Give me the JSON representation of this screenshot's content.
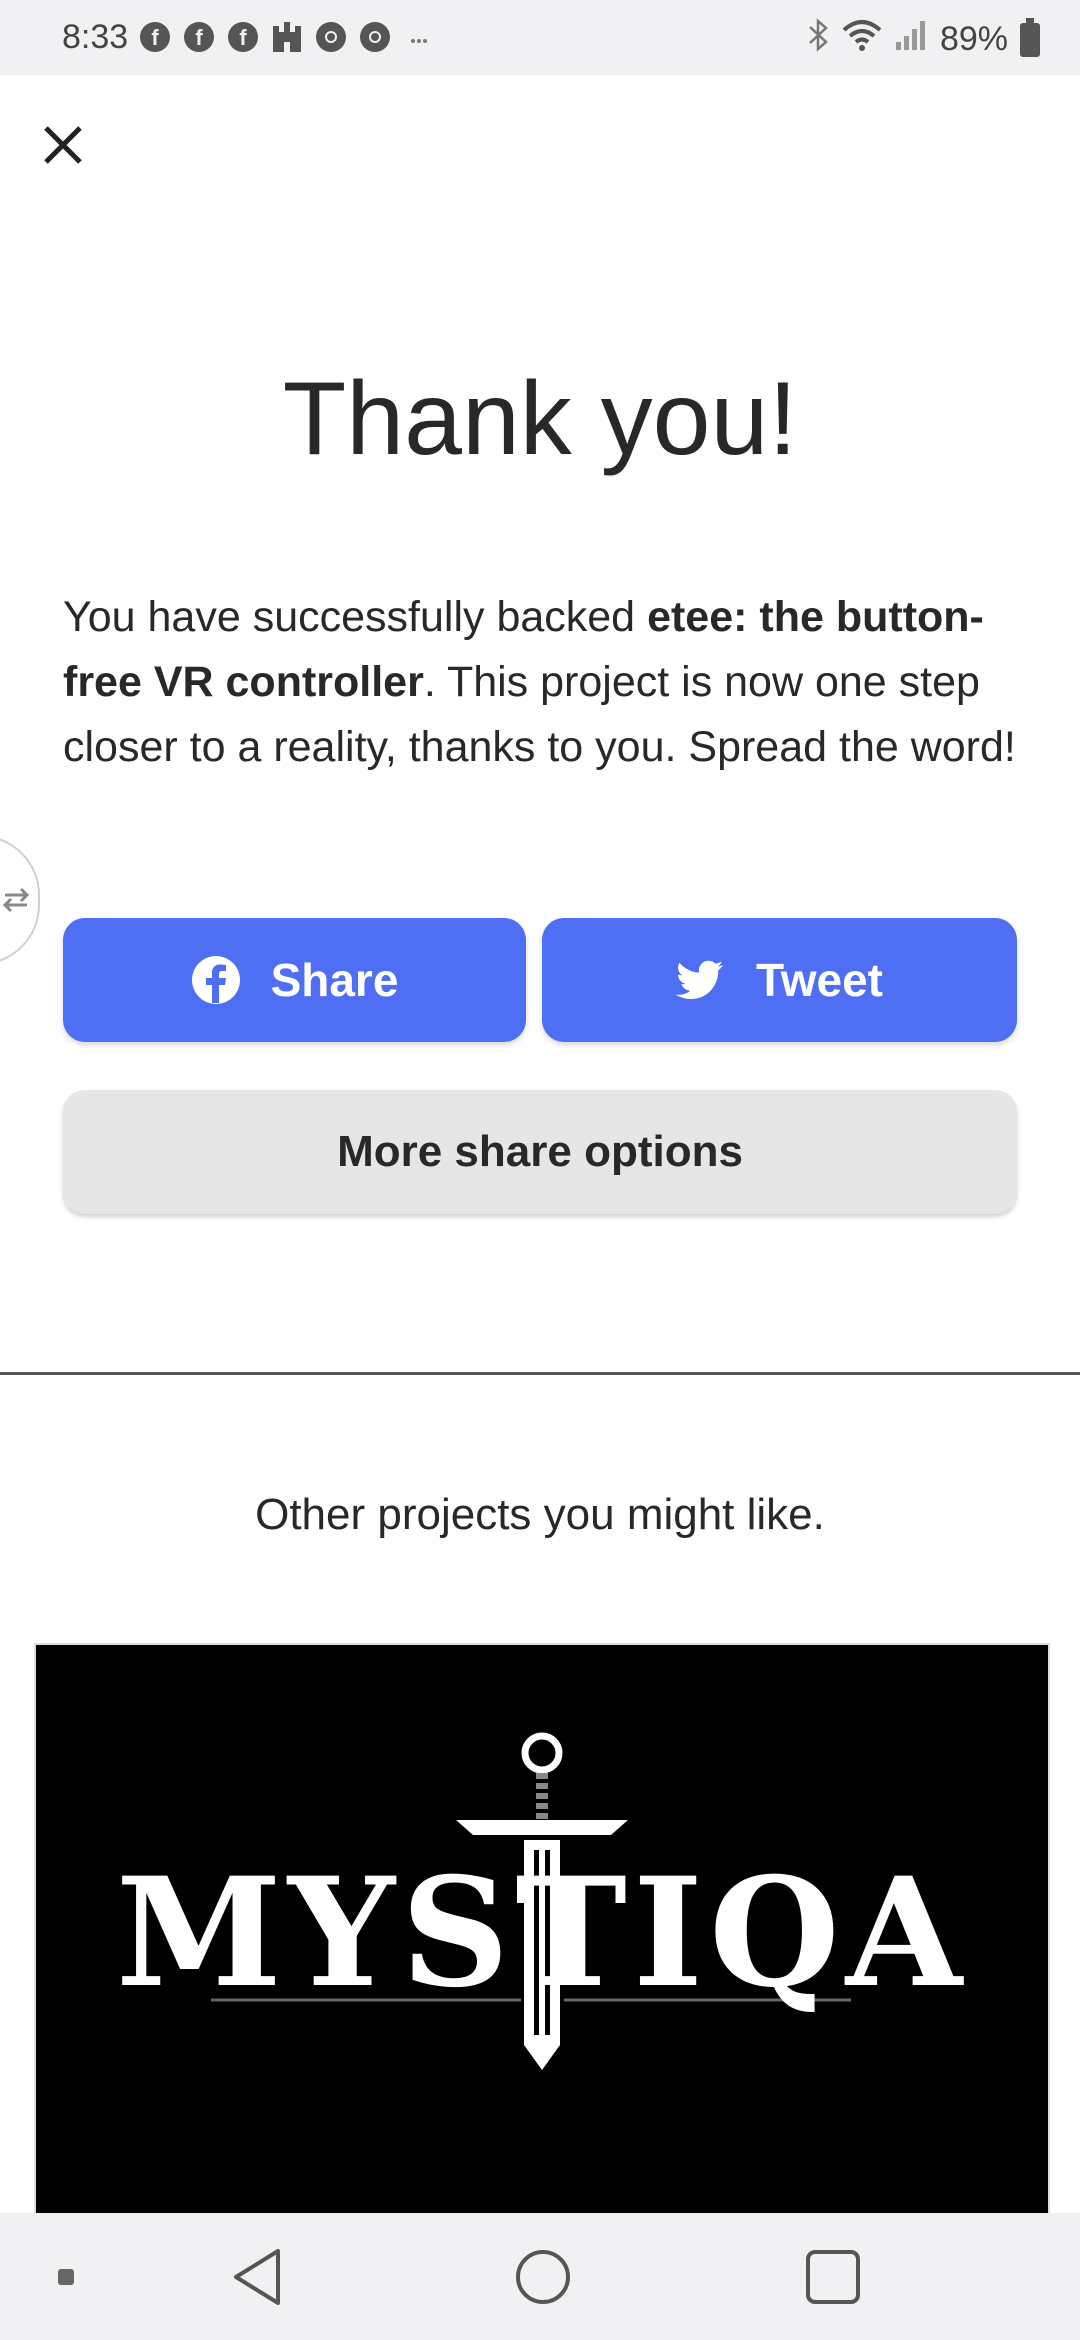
{
  "status_bar": {
    "time": "8:33",
    "battery": "89%",
    "icons": [
      "facebook-icon",
      "facebook-icon",
      "facebook-icon",
      "castle-icon",
      "chrome-icon",
      "chrome-icon",
      "more-dots-icon"
    ],
    "right_icons": [
      "bluetooth-icon",
      "wifi-icon",
      "signal-icon",
      "battery-icon"
    ]
  },
  "header": {
    "close_icon": "close-icon"
  },
  "main": {
    "title": "Thank you!",
    "message_pre": "You have successfully backed ",
    "project_name": "etee: the button-free VR controller",
    "message_post": ". This project is now one step closer to a reality, thanks to you. Spread the word!",
    "share_label": "Share",
    "tweet_label": "Tweet",
    "more_label": "More share options"
  },
  "recommendations": {
    "heading": "Other projects you might like.",
    "project_logo_text": "MYSTIQA"
  },
  "colors": {
    "primary_button": "#4e6ef4",
    "secondary_button": "#e6e6e6",
    "text": "#282828"
  }
}
